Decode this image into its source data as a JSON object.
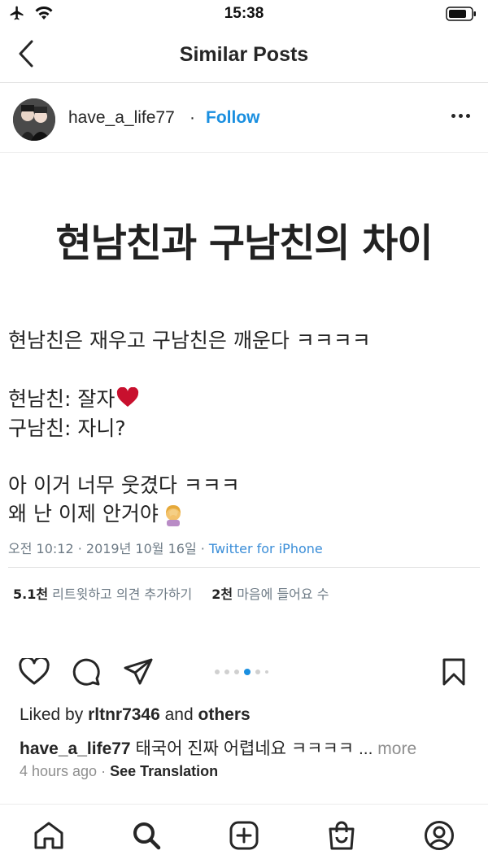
{
  "status_bar": {
    "time": "15:38",
    "icons": [
      "airplane-icon",
      "wifi-icon",
      "battery-icon"
    ]
  },
  "nav": {
    "back_icon": "chevron-left-icon",
    "title": "Similar Posts"
  },
  "post_header": {
    "username": "have_a_life77",
    "separator": "·",
    "follow_label": "Follow",
    "more_icon": "more-horizontal-icon"
  },
  "post_image": {
    "headline": "현남친과 구남친의 차이",
    "line1": "현남친은 재우고 구남친은 깨운다 ㅋㅋㅋㅋ",
    "line2": "현남친: 잘자",
    "line3": "구남친: 자니?",
    "line4": "아 이거 너무 웃겼다 ㅋㅋㅋ",
    "line5": "왜 난 이제 안거야",
    "meta_time": "오전 10:12 · 2019년 10월 16일 · ",
    "meta_source": "Twitter for iPhone",
    "retweets_count": "5.1천",
    "retweets_label": " 리트윗하고 의견 추가하기",
    "likes_count": "2천",
    "likes_label": " 마음에 들어요 수"
  },
  "actions": {
    "icons": [
      "heart-icon",
      "comment-icon",
      "share-icon",
      "bookmark-icon"
    ],
    "carousel_total": 6,
    "carousel_active": 4
  },
  "likes_row": {
    "prefix": "Liked by ",
    "user": "rltnr7346",
    "middle": " and ",
    "others": "others"
  },
  "caption": {
    "username": "have_a_life77",
    "text": " 태국어 진짜 어렵네요 ㅋㅋㅋㅋ ... ",
    "more": "more"
  },
  "time_row": {
    "time": "4 hours ago",
    "separator": " · ",
    "see_translation": "See Translation"
  },
  "tabbar": {
    "icons": [
      "home-icon",
      "search-icon",
      "new-post-icon",
      "shop-icon",
      "profile-icon"
    ]
  },
  "colors": {
    "accent": "#1a8fe0",
    "text": "#262626",
    "muted": "#8e8e8e",
    "heart": "#c8102e"
  }
}
